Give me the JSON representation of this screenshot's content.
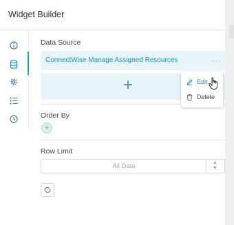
{
  "header": {
    "title": "Widget Builder"
  },
  "sidebar": {
    "items": [
      {
        "icon": "info-icon",
        "active": false
      },
      {
        "icon": "database-icon",
        "active": true
      },
      {
        "icon": "settings-gear-icon",
        "active": false
      },
      {
        "icon": "list-icon",
        "active": false
      },
      {
        "icon": "clock-icon",
        "active": false
      }
    ]
  },
  "data_source": {
    "label": "Data Source",
    "value": "ConnectWise Manage Assigned Resources",
    "more_icon": "more-options-icon"
  },
  "context_menu": {
    "edit_label": "Edit",
    "delete_label": "Delete"
  },
  "order_by": {
    "label": "Order By"
  },
  "row_limit": {
    "label": "Row Limit",
    "value": "All Data"
  },
  "colors": {
    "accent": "#1c91b4",
    "active_bar": "#14a3b8",
    "row_bg": "#e7f5f9"
  }
}
